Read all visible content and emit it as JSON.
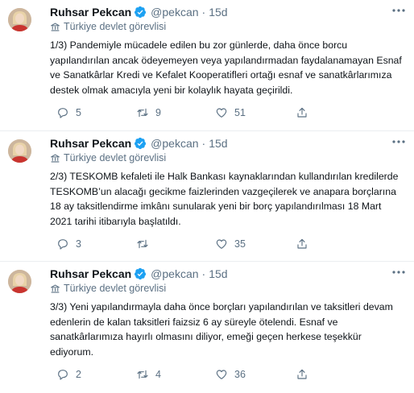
{
  "tweets": [
    {
      "author_name": "Ruhsar Pekcan",
      "handle": "@pekcan",
      "separator": "·",
      "time": "15d",
      "label": "Türkiye devlet görevlisi",
      "text": "1/3) Pandemiyle mücadele edilen bu zor günlerde, daha önce borcu yapılandırılan ancak ödeyemeyen veya yapılandırmadan faydalanamayan Esnaf ve Sanatkârlar Kredi ve Kefalet Kooperatifleri ortağı esnaf ve sanatkârlarımıza destek olmak amacıyla yeni bir kolaylık hayata geçirildi.",
      "replies": "5",
      "retweets": "9",
      "likes": "51"
    },
    {
      "author_name": "Ruhsar Pekcan",
      "handle": "@pekcan",
      "separator": "·",
      "time": "15d",
      "label": "Türkiye devlet görevlisi",
      "text": "2/3) TESKOMB kefaleti ile Halk Bankası kaynaklarından kullandırılan kredilerde TESKOMB’un alacağı gecikme faizlerinden vazgeçilerek ve anapara borçlarına 18 ay taksitlendirme imkânı sunularak yeni bir borç yapılandırılması 18 Mart 2021 tarihi itibarıyla başlatıldı.",
      "replies": "3",
      "retweets": "",
      "likes": "35"
    },
    {
      "author_name": "Ruhsar Pekcan",
      "handle": "@pekcan",
      "separator": "·",
      "time": "15d",
      "label": "Türkiye devlet görevlisi",
      "text": "3/3) Yeni yapılandırmayla daha önce borçları yapılandırılan ve taksitleri devam edenlerin de kalan taksitleri faizsiz 6 ay süreyle ötelendi. Esnaf ve sanatkârlarımıza hayırlı olmasını diliyor, emeği geçen herkese teşekkür ediyorum.",
      "replies": "2",
      "retweets": "4",
      "likes": "36"
    }
  ],
  "icons": {
    "verified": "verified-badge-icon",
    "more": "more-options-icon",
    "government": "government-label-icon",
    "reply": "reply-icon",
    "retweet": "retweet-icon",
    "like": "like-icon",
    "share": "share-icon"
  },
  "colors": {
    "accent": "#1da1f2",
    "secondary_text": "#5b7083",
    "primary_text": "#0f1419",
    "divider": "#ebeef0"
  }
}
